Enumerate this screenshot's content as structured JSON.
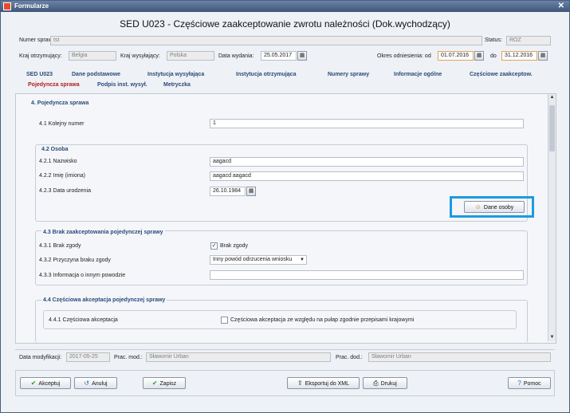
{
  "window": {
    "title": "Formularze",
    "close_glyph": "✕"
  },
  "form": {
    "title": "SED U023 - Częściowe zaakceptowanie zwrotu należności (Dok.wychodzący)"
  },
  "header": {
    "case_no_label": "Numer sprawy:",
    "case_no_value": "tst",
    "status_label": "Status:",
    "status_value": "ROZ",
    "recv_country_label": "Kraj otrzymujący:",
    "recv_country_value": "Belgia",
    "send_country_label": "Kraj wysyłający:",
    "send_country_value": "Polska",
    "issue_date_label": "Data wydania:",
    "issue_date_value": "25.05.2017",
    "period_label": "Okres odniesienia: od",
    "period_from": "01.07.2016",
    "period_to_label": "do",
    "period_to": "31.12.2016"
  },
  "tabs": {
    "row1": [
      "SED U023",
      "Dane podstawowe",
      "Instytucja wysyłająca",
      "Instytucja otrzymująca",
      "Numery sprawy",
      "Informacje ogólne",
      "Częściowe zaakceptow."
    ],
    "row2": [
      "Pojedyncza sprawa",
      "Podpis inst. wysył.",
      "Metryczka"
    ],
    "active": "Pojedyncza sprawa"
  },
  "section4": {
    "title": "4. Pojedyncza sprawa",
    "f41_label": "4.1 Kolejny numer",
    "f41_value": "1",
    "s42_title": "4.2 Osoba",
    "f421_label": "4.2.1 Nazwisko",
    "f421_value": "aagacd",
    "f422_label": "4.2.2 Imię (imiona)",
    "f422_value": "aagacd aagacd",
    "f423_label": "4.2.3 Data urodzenia",
    "f423_value": "26.10.1984",
    "person_button": "Dane osoby",
    "s43_title": "4.3 Brak zaakceptowania pojedynczej sprawy",
    "f431_label": "4.3.1 Brak zgody",
    "f431_check_label": "Brak zgody",
    "f431_checked": true,
    "f432_label": "4.3.2 Przyczyna braku zgody",
    "f432_value": "Inny powód odrzucenia wniosku",
    "f433_label": "4.3.3 Informacja o innym powodzie",
    "f433_value": "",
    "s44_title": "4.4 Częściowa akceptacja pojedynczej sprawy",
    "f441_label": "4.4.1 Częściowa akceptacja",
    "f441_check_label": "Częściowa akceptacja ze względu na pułap zgodnie przepisami krajowymi",
    "f441_checked": false
  },
  "meta": {
    "mod_date_label": "Data modyfikacji:",
    "mod_date_value": "2017-05-25",
    "mod_user_label": "Prac. mod.:",
    "mod_user_value": "Sławomir Urban",
    "add_user_label": "Prac. dod.:",
    "add_user_value": "Sławomir Urban"
  },
  "footer": {
    "accept": "Akceptuj",
    "cancel": "Anuluj",
    "save": "Zapisz",
    "export": "Eksportuj do XML",
    "print": "Drukuj",
    "help": "Pomoc"
  },
  "icons": {
    "accept": "check-icon",
    "cancel": "undo-icon",
    "save": "check-icon",
    "export": "export-icon",
    "print": "printer-icon",
    "help": "help-icon",
    "person": "users-icon",
    "calendar": "calendar-icon"
  },
  "colors": {
    "accent_blue": "#2b4a7a",
    "active_tab_red": "#b11d1d",
    "highlight": "#1e9ae0",
    "date_border": "#e0a25a"
  }
}
